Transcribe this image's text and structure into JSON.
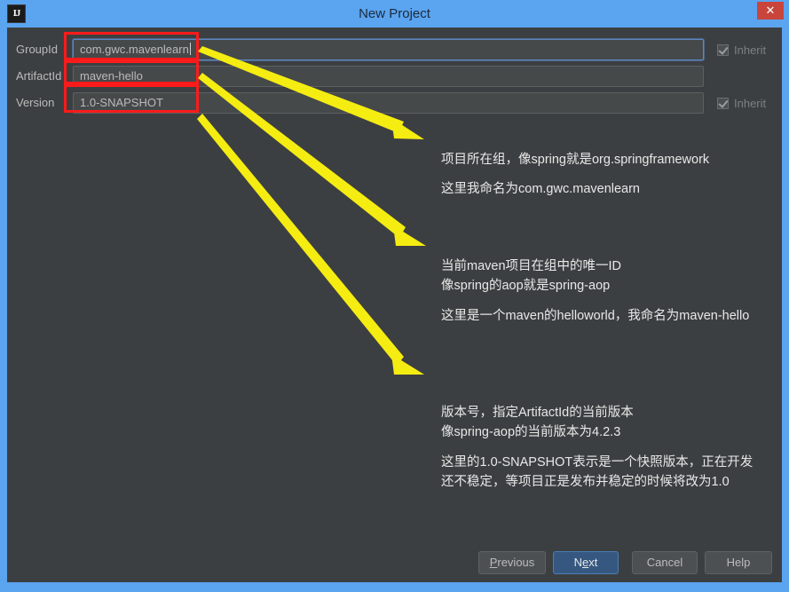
{
  "window": {
    "title": "New Project",
    "logo_text": "IJ",
    "close_label": "✕",
    "titlebar_color": "#5ba4f0",
    "body_color": "#3c3f41",
    "close_color": "#c9453c"
  },
  "form": {
    "rows": [
      {
        "label": "GroupId",
        "value": "com.gwc.mavenlearn",
        "focused": true,
        "has_inherit": true,
        "inherit_label": "Inherit",
        "inherit_checked": true
      },
      {
        "label": "ArtifactId",
        "value": "maven-hello",
        "focused": false,
        "has_inherit": false,
        "inherit_label": "",
        "inherit_checked": false
      },
      {
        "label": "Version",
        "value": "1.0-SNAPSHOT",
        "focused": false,
        "has_inherit": true,
        "inherit_label": "Inherit",
        "inherit_checked": true
      }
    ]
  },
  "annotations": {
    "highlight_color": "#fc1b1b",
    "arrow_color": "#f5ec12",
    "blocks": [
      {
        "target": "GroupId",
        "para1_line1": "项目所在组，像spring就是org.springframework",
        "para2_line1": "这里我命名为com.gwc.mavenlearn"
      },
      {
        "target": "ArtifactId",
        "para1_line1": "当前maven项目在组中的唯一ID",
        "para1_line2": "像spring的aop就是spring-aop",
        "para2_line1": "这里是一个maven的helloworld，我命名为maven-hello"
      },
      {
        "target": "Version",
        "para1_line1": "版本号，指定ArtifactId的当前版本",
        "para1_line2": "像spring-aop的当前版本为4.2.3",
        "para2_line1": "这里的1.0-SNAPSHOT表示是一个快照版本，正在开发",
        "para2_line2": "还不稳定，等项目正是发布并稳定的时候将改为1.0"
      }
    ]
  },
  "buttons": {
    "previous": {
      "prefix": "P",
      "rest": "revious"
    },
    "next": {
      "prefix_plain": "N",
      "mnemonic": "e",
      "rest": "xt"
    },
    "cancel": {
      "label": "Cancel"
    },
    "help": {
      "label": "Help"
    }
  }
}
